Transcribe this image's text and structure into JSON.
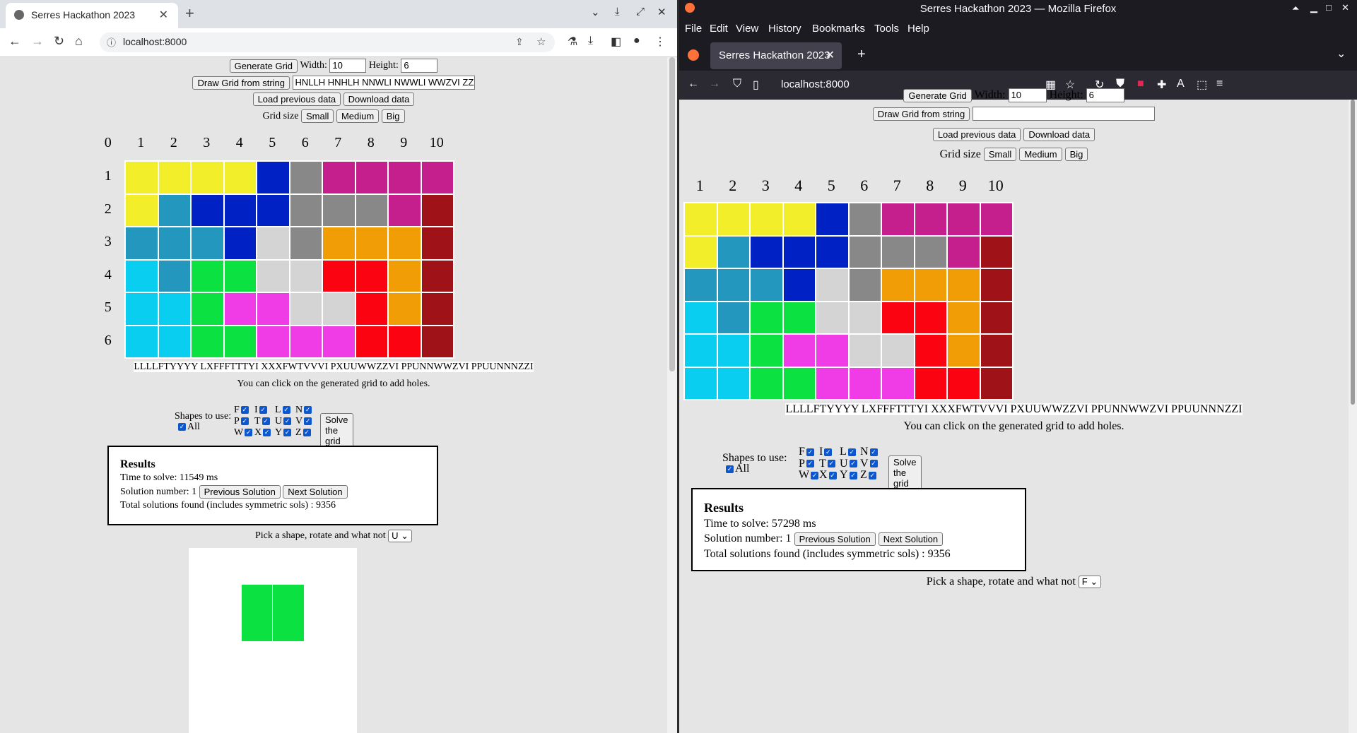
{
  "colors": {
    "F": "#ef3ce6",
    "I": "#0acef0",
    "L": "#f2ee2a",
    "N": "#c41f8c",
    "P": "#0022c4",
    "T": "#888888",
    "U": "#d4d4d4",
    "V": "#f19e06",
    "W": "#9f1218",
    "X": "#0be242",
    "Y": "#2397bd",
    "Z": "#fb0310"
  },
  "grid_rows": [
    "LLLLPTNNNN",
    "LYPPPTTTNW",
    "YYYPUTVVVW",
    "IYXXUUZZVW",
    "IIXFFUUZVW",
    "IIXXFFFZZW"
  ],
  "col_labels": [
    "0",
    "1",
    "2",
    "3",
    "4",
    "5",
    "6",
    "7",
    "8",
    "9",
    "10"
  ],
  "row_labels": [
    "1",
    "2",
    "3",
    "4",
    "5",
    "6"
  ],
  "chrome": {
    "tab_title": "Serres Hackathon 2023",
    "new_tab": "+",
    "url": "localhost:8000",
    "page": {
      "generate_label": "Generate Grid",
      "width_label": "Width:",
      "width_value": "10",
      "height_label": "Height:",
      "height_value": "6",
      "draw_label": "Draw Grid from string",
      "draw_value": "HNLLH HNHLH NNWLI NWWLI WWZVI ZZZVI ZV",
      "load_label": "Load previous data",
      "download_label": "Download data",
      "grid_size_label": "Grid size",
      "small": "Small",
      "medium": "Medium",
      "big": "Big",
      "grid_string": "LLLLFTYYYY LXFFFTTTYI XXXFWTVVVI PXUUWWZZVI PPUNNWWZVI PPUUNNNZZI",
      "holes_hint": "You can click on the generated grid to add holes.",
      "shapes_label": "Shapes to use:",
      "all_label": "All",
      "solve_label": "Solve the grid",
      "results_title": "Results",
      "time_text": "Time to solve: 11549 ms",
      "solution_label": "Solution number: 1",
      "prev_label": "Previous Solution",
      "next_label": "Next Solution",
      "total_text": "Total solutions found (includes symmetric sols) : 9356",
      "pick_label": "Pick a shape, rotate and what not",
      "pick_value": "U"
    }
  },
  "firefox": {
    "window_title": "Serres Hackathon 2023 — Mozilla Firefox",
    "menu": [
      "File",
      "Edit",
      "View",
      "History",
      "Bookmarks",
      "Tools",
      "Help"
    ],
    "tab_title": "Serres Hackathon 2023",
    "url": "localhost:8000",
    "page": {
      "generate_label": "Generate Grid",
      "width_label": "Width:",
      "width_value": "10",
      "height_label": "Height:",
      "height_value": "6",
      "draw_label": "Draw Grid from string",
      "draw_value": "",
      "load_label": "Load previous data",
      "download_label": "Download data",
      "grid_size_label": "Grid size",
      "small": "Small",
      "medium": "Medium",
      "big": "Big",
      "grid_string": "LLLLFTYYYY LXFFFTTTYI XXXFWTVVVI PXUUWWZZVI PPUNNWWZVI PPUUNNNZZI",
      "holes_hint": "You can click on the generated grid to add holes.",
      "shapes_label": "Shapes to use:",
      "all_label": "All",
      "solve_label": "Solve the grid",
      "results_title": "Results",
      "time_text": "Time to solve: 57298 ms",
      "solution_label": "Solution number: 1",
      "prev_label": "Previous Solution",
      "next_label": "Next Solution",
      "total_text": "Total solutions found (includes symmetric sols) : 9356",
      "pick_label": "Pick a shape, rotate and what not",
      "pick_value": "F"
    }
  },
  "shape_rows": [
    [
      "F",
      "I",
      "L",
      "N"
    ],
    [
      "P",
      "T",
      "U",
      "V"
    ],
    [
      "W",
      "X",
      "Y",
      "Z"
    ]
  ],
  "checkmark": "✓",
  "preview_color": "#0be242"
}
